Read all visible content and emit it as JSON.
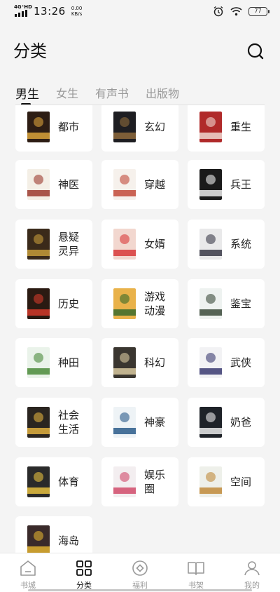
{
  "status_bar": {
    "network_label": "4G⁺HD",
    "time": "13:26",
    "speed_value": "0.00",
    "speed_unit": "KB/s",
    "battery": "77",
    "icons": [
      "alarm-icon",
      "wifi-icon",
      "battery-icon"
    ]
  },
  "header": {
    "title": "分类",
    "search_icon": "search-icon"
  },
  "tabs": [
    {
      "label": "男生",
      "active": true
    },
    {
      "label": "女生",
      "active": false
    },
    {
      "label": "有声书",
      "active": false
    },
    {
      "label": "出版物",
      "active": false
    }
  ],
  "categories": [
    {
      "label": "都市",
      "cover_color": "#2d1d14",
      "accent": "#d9a23a"
    },
    {
      "label": "玄幻",
      "cover_color": "#1e1e22",
      "accent": "#8e6a3c"
    },
    {
      "label": "重生",
      "cover_color": "#b02a2a",
      "accent": "#f0d7d0"
    },
    {
      "label": "神医",
      "cover_color": "#f4efe6",
      "accent": "#9b3a2e"
    },
    {
      "label": "穿越",
      "cover_color": "#f6f1ec",
      "accent": "#c24a3a"
    },
    {
      "label": "兵王",
      "cover_color": "#1a1a1a",
      "accent": "#ececec"
    },
    {
      "label": "悬疑灵异",
      "cover_color": "#3a2a1a",
      "accent": "#c59b3a"
    },
    {
      "label": "女婿",
      "cover_color": "#f2d7cf",
      "accent": "#d83a3a"
    },
    {
      "label": "系统",
      "cover_color": "#e9e9ea",
      "accent": "#3a3a48"
    },
    {
      "label": "历史",
      "cover_color": "#2a1a12",
      "accent": "#d23a2a"
    },
    {
      "label": "游戏动漫",
      "cover_color": "#e9b24a",
      "accent": "#3a6a2a"
    },
    {
      "label": "鉴宝",
      "cover_color": "#eef2f0",
      "accent": "#3a4a3a"
    },
    {
      "label": "种田",
      "cover_color": "#eaf3ea",
      "accent": "#4a8a3a"
    },
    {
      "label": "科幻",
      "cover_color": "#3a3630",
      "accent": "#d9c9a0"
    },
    {
      "label": "武侠",
      "cover_color": "#f2f2f4",
      "accent": "#3a3a70"
    },
    {
      "label": "社会生活",
      "cover_color": "#2a2520",
      "accent": "#e0b040"
    },
    {
      "label": "神豪",
      "cover_color": "#eef3f6",
      "accent": "#2a5a8a"
    },
    {
      "label": "奶爸",
      "cover_color": "#1e2228",
      "accent": "#eaeaea"
    },
    {
      "label": "体育",
      "cover_color": "#2a2a2a",
      "accent": "#e6c040"
    },
    {
      "label": "娱乐圈",
      "cover_color": "#f3eef0",
      "accent": "#d04a6a"
    },
    {
      "label": "空间",
      "cover_color": "#eef0ea",
      "accent": "#c08a3a"
    },
    {
      "label": "海岛",
      "cover_color": "#3a2a2a",
      "accent": "#e0b030"
    }
  ],
  "bottom_nav": [
    {
      "label": "书城",
      "icon": "home-icon",
      "active": false
    },
    {
      "label": "分类",
      "icon": "grid-icon",
      "active": true
    },
    {
      "label": "福利",
      "icon": "gift-icon",
      "active": false
    },
    {
      "label": "书架",
      "icon": "bookshelf-icon",
      "active": false
    },
    {
      "label": "我的",
      "icon": "profile-icon",
      "active": false
    }
  ]
}
